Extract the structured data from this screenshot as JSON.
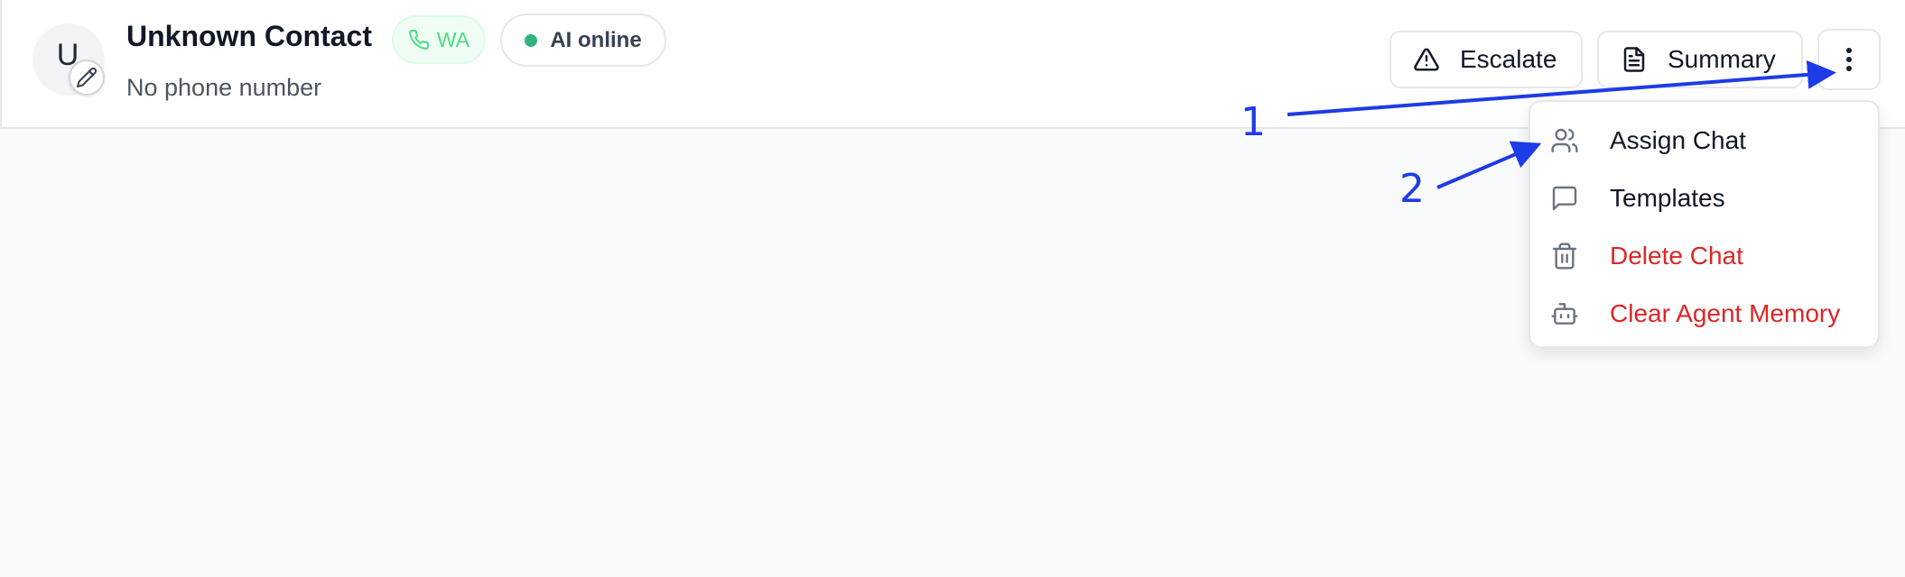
{
  "contact": {
    "avatar_initial": "U",
    "name": "Unknown Contact",
    "subtitle": "No phone number"
  },
  "badges": {
    "channel_label": "WA",
    "status_label": "AI online"
  },
  "toolbar": {
    "escalate_label": "Escalate",
    "summary_label": "Summary"
  },
  "menu": {
    "items": [
      {
        "label": "Assign Chat",
        "icon": "users-icon",
        "danger": false
      },
      {
        "label": "Templates",
        "icon": "message-square-icon",
        "danger": false
      },
      {
        "label": "Delete Chat",
        "icon": "trash-icon",
        "danger": true
      },
      {
        "label": "Clear Agent Memory",
        "icon": "bot-icon",
        "danger": true
      }
    ]
  },
  "annotations": {
    "step1": "1",
    "step2": "2"
  },
  "colors": {
    "danger": "#dc2626",
    "online": "#34b27b",
    "whatsapp": "#4ade80",
    "annotation": "#1d3be6",
    "icon": "#6b7280"
  }
}
